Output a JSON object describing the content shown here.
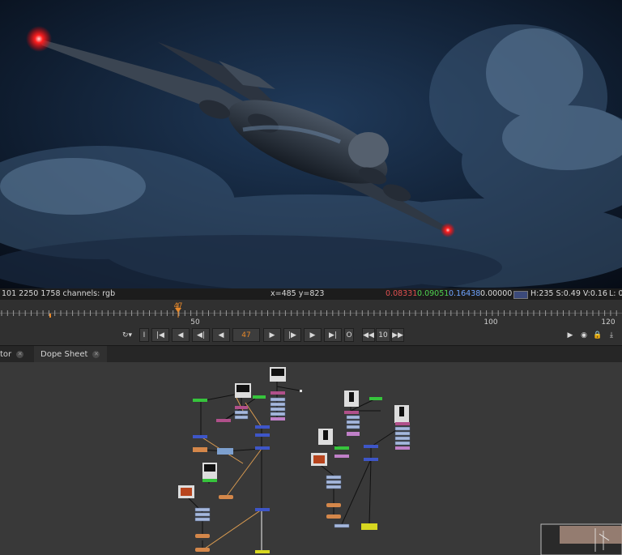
{
  "info_bar": {
    "format": "101 2250 1758 channels: rgb",
    "coords": "x=485 y=823",
    "r": "0.08331",
    "g": "0.09051",
    "b": "0.16438",
    "a": "0.00000",
    "hsv": "H:235 S:0.49 V:0.16",
    "l": "L: 0"
  },
  "timeline": {
    "current_frame_label": "47",
    "ticks": [
      "50",
      "100",
      "120"
    ]
  },
  "transport": {
    "current_frame": "47",
    "increment": "10",
    "buttons": {
      "in_marker": "I",
      "out_marker": "O"
    }
  },
  "tabs": [
    {
      "label": "tor"
    },
    {
      "label": "Dope Sheet"
    }
  ],
  "colors": {
    "panel": "#393939",
    "timeline_orange": "#e8892a",
    "r_text": "#e05050",
    "g_text": "#4fd24f",
    "b_text": "#6fa4ff"
  }
}
